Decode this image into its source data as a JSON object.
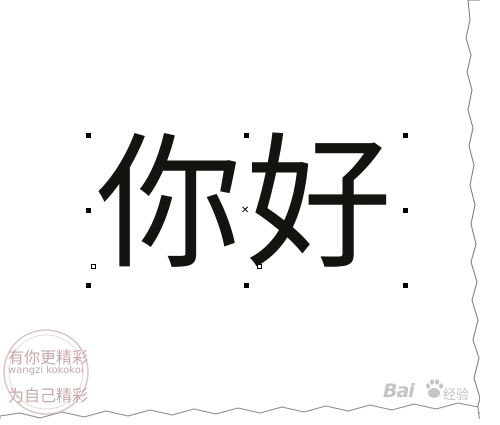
{
  "selection": {
    "text": "你好"
  },
  "watermark": {
    "stamp_line1": "有你更精彩",
    "stamp_line2": "wangzi kokokoi",
    "stamp_line3": "为自己精彩"
  },
  "baidu": {
    "brand": "Bai",
    "suffix": "经验"
  },
  "colors": {
    "text": "#15130f",
    "handle": "#000000",
    "stamp": "#c9a8a8",
    "watermark": "#c4c4c4"
  }
}
